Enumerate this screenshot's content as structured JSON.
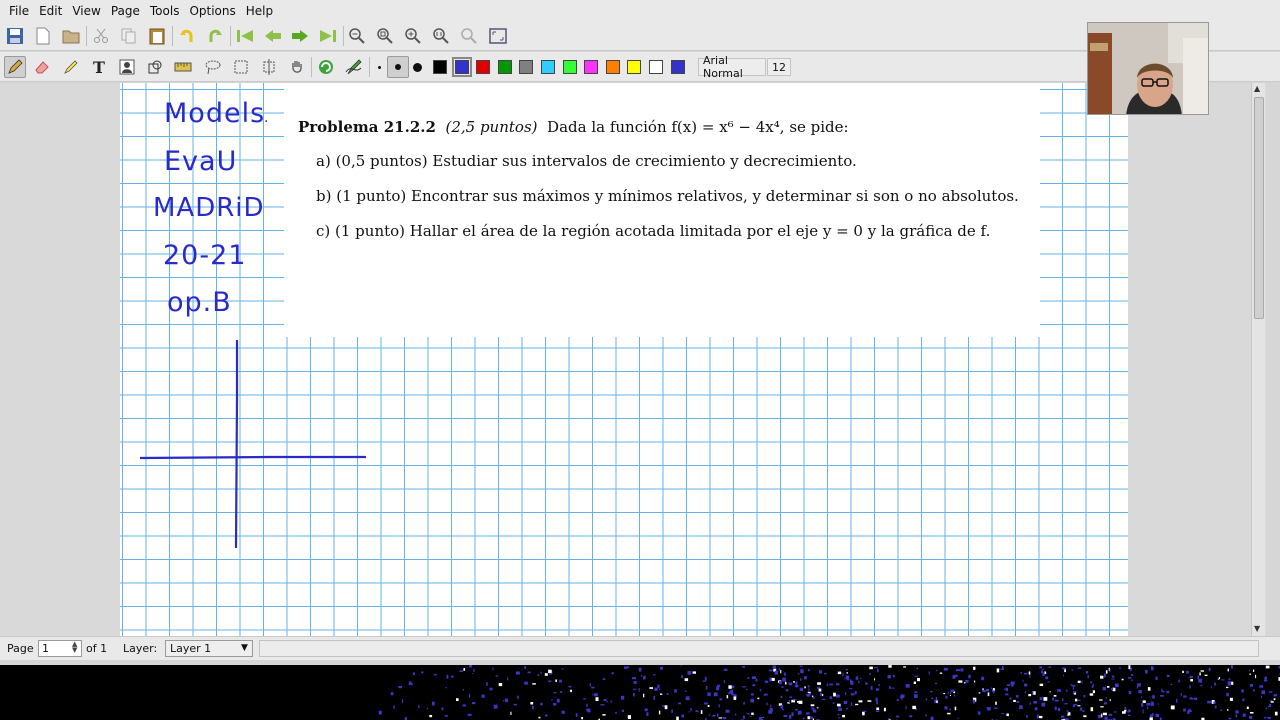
{
  "menu": {
    "file": "File",
    "edit": "Edit",
    "view": "View",
    "page": "Page",
    "tools": "Tools",
    "options": "Options",
    "help": "Help"
  },
  "toolbar2": {
    "font_name": "Arial Normal",
    "font_size": "12",
    "colors": [
      "#000000",
      "#3333cc",
      "#e00000",
      "#009900",
      "#808080",
      "#33ccff",
      "#33ff33",
      "#ff33ff",
      "#ff8000",
      "#ffff00",
      "#ffffff",
      "#3333cc"
    ],
    "selected_color": "#3333cc"
  },
  "handwriting": {
    "line1": "Models",
    "line2": "EvaU",
    "line3": "MADRiD",
    "line4": "20-21",
    "line5": "op.B",
    "ink_color": "#2a2ac8"
  },
  "problem": {
    "title_bold": "Problema 21.2.2",
    "title_points": "(2,5 puntos)",
    "title_text": "Dada la función f(x) = x⁶ − 4x⁴, se pide:",
    "part_a": "a)  (0,5 puntos) Estudiar sus intervalos de crecimiento y decrecimiento.",
    "part_b": "b)  (1 punto) Encontrar sus máximos y mínimos relativos, y determinar si son o no absolutos.",
    "part_c": "c)  (1 punto) Hallar el área de la región acotada limitada por el eje y = 0 y la gráfica de f."
  },
  "statusbar": {
    "page_label": "Page",
    "page_value": "1",
    "of_label": "of 1",
    "layer_label": "Layer:",
    "layer_value": "Layer 1"
  },
  "colors": {
    "grid": "#66b3e8",
    "ui_bg": "#e9e9e9"
  }
}
